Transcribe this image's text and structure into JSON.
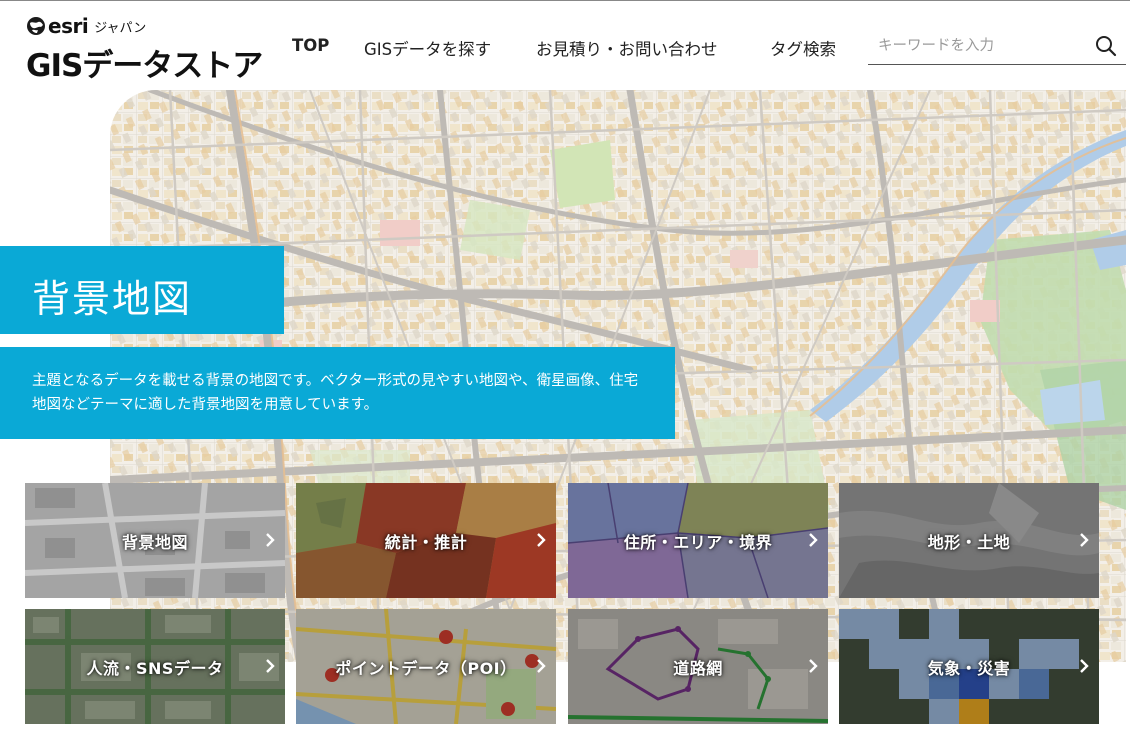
{
  "header": {
    "logo_brand": "esri",
    "logo_region": "ジャパン",
    "logo_title": "GISデータストア",
    "nav": [
      {
        "label": "TOP"
      },
      {
        "label": "GISデータを探す"
      },
      {
        "label": "お見積り・お問い合わせ"
      },
      {
        "label": "タグ検索"
      }
    ],
    "search": {
      "placeholder": "キーワードを入力",
      "value": ""
    }
  },
  "hero": {
    "title": "背景地図",
    "description": "主題となるデータを載せる背景の地図です。ベクター形式の見やすい地図や、衛星画像、住宅地図などテーマに適した背景地図を用意しています。"
  },
  "categories": [
    {
      "label": "背景地図"
    },
    {
      "label": "統計・推計"
    },
    {
      "label": "住所・エリア・境界"
    },
    {
      "label": "地形・土地"
    },
    {
      "label": "人流・SNSデータ"
    },
    {
      "label": "ポイントデータ（POI）"
    },
    {
      "label": "道路網"
    },
    {
      "label": "気象・災害"
    }
  ],
  "colors": {
    "accent": "#0aa9d6",
    "text": "#222222",
    "map_background": "#f1ece1",
    "map_roads": "#b7b3ad",
    "map_buildings": "#e8d3a8"
  },
  "icons": {
    "logo": "esri-globe-icon",
    "search": "search-icon",
    "tile_arrow": "chevron-right-icon"
  }
}
